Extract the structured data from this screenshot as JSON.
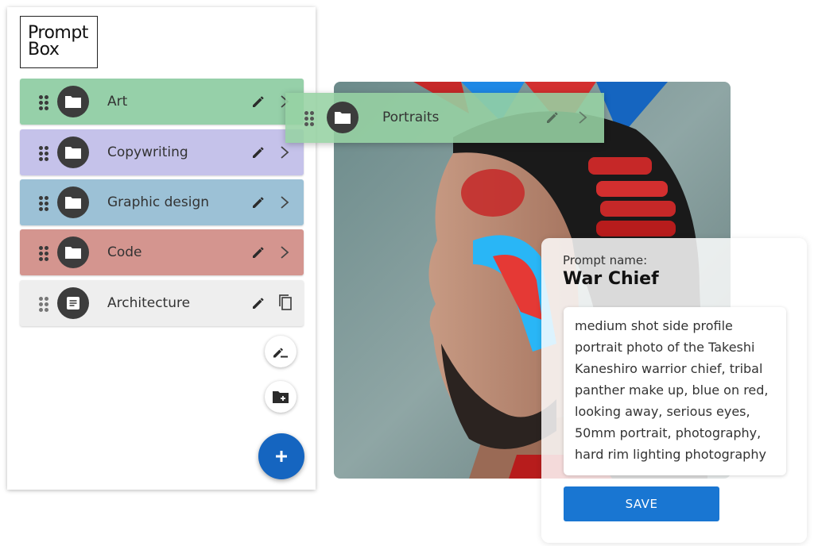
{
  "logo": {
    "line1": "Prompt",
    "line2": "Box"
  },
  "folders": [
    {
      "label": "Art",
      "color": "#96d0a9",
      "type": "folder"
    },
    {
      "label": "Copywriting",
      "color": "#c5c2ea",
      "type": "folder"
    },
    {
      "label": "Graphic design",
      "color": "#9cc1d6",
      "type": "folder"
    },
    {
      "label": "Code",
      "color": "#d4958f",
      "type": "folder"
    },
    {
      "label": "Architecture",
      "color": "#eeeeee",
      "type": "prompt"
    }
  ],
  "dragged_item": {
    "label": "Portraits",
    "color": "#96d2a3"
  },
  "actions": {
    "new_prompt_icon": "edit-pen-icon",
    "new_folder_icon": "create-folder-icon",
    "add_icon": "plus-icon",
    "fab_color": "#1565c0"
  },
  "prompt": {
    "name_label": "Prompt name:",
    "name": "War Chief",
    "text": "medium shot side profile portrait photo of the Takeshi Kaneshiro warrior chief, tribal panther make up, blue on red, looking away, serious eyes, 50mm portrait, photography, hard rim lighting photography",
    "save_label": "SAVE"
  }
}
